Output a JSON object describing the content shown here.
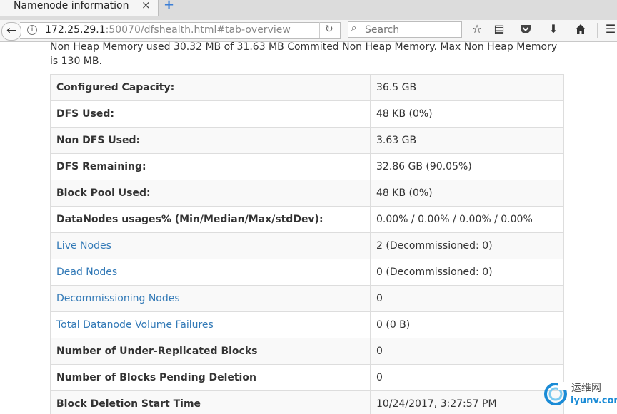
{
  "browser": {
    "tab_title": "Namenode information",
    "tab_close": "×",
    "new_tab": "+",
    "url_host": "172.25.29.1",
    "url_rest": ":50070/dfshealth.html#tab-overview",
    "search_placeholder": "Search"
  },
  "page": {
    "heap_text": "Non Heap Memory used 30.32 MB of 31.63 MB Commited Non Heap Memory. Max Non Heap Memory is 130 MB.",
    "rows": [
      {
        "label": "Configured Capacity:",
        "value": "36.5 GB"
      },
      {
        "label": "DFS Used:",
        "value": "48 KB (0%)"
      },
      {
        "label": "Non DFS Used:",
        "value": "3.63 GB"
      },
      {
        "label": "DFS Remaining:",
        "value": "32.86 GB (90.05%)"
      },
      {
        "label": "Block Pool Used:",
        "value": "48 KB (0%)"
      },
      {
        "label": "DataNodes usages% (Min/Median/Max/stdDev):",
        "value": "0.00% / 0.00% / 0.00% / 0.00%"
      },
      {
        "label": "Live Nodes",
        "value": "2 (Decommissioned: 0)"
      },
      {
        "label": "Dead Nodes",
        "value": "0 (Decommissioned: 0)"
      },
      {
        "label": "Decommissioning Nodes",
        "value": "0"
      },
      {
        "label": "Total Datanode Volume Failures",
        "value": "0 (0 B)"
      },
      {
        "label": "Number of Under-Replicated Blocks",
        "value": "0"
      },
      {
        "label": "Number of Blocks Pending Deletion",
        "value": "0"
      },
      {
        "label": "Block Deletion Start Time",
        "value": "10/24/2017, 3:27:57 PM"
      }
    ]
  },
  "watermark": {
    "cn": "运维网",
    "en": "iyunv.com"
  },
  "colors": {
    "link": "#337ab7",
    "border": "#dddddd",
    "stripe": "#f9f9f9"
  }
}
